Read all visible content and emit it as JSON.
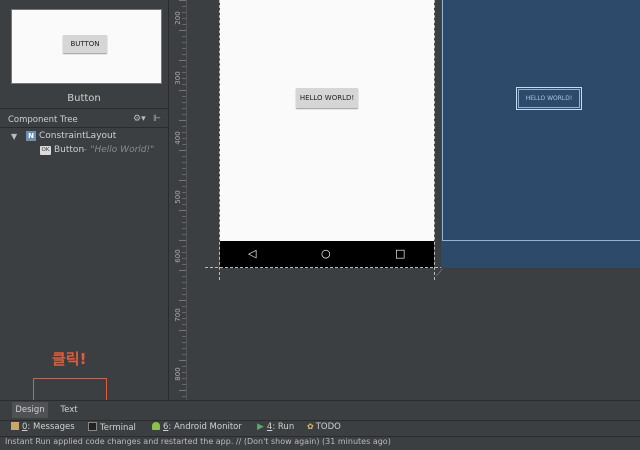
{
  "left_panel": {
    "preview_button_label": "BUTTON",
    "heading": "Button",
    "component_tree": {
      "title": "Component Tree",
      "root_label": "ConstraintLayout",
      "child_badge": "OK",
      "child_label": "Button",
      "child_desc": "– \"Hello World!\""
    }
  },
  "ruler": {
    "labels": [
      "200",
      "300",
      "400",
      "500",
      "600",
      "700",
      "800"
    ]
  },
  "canvas": {
    "hello_button_label": "HELLO WORLD!",
    "blueprint_button_label": "HELLO WORLD!"
  },
  "annotation": {
    "click_text": "클릭!",
    "color": "#e05c3a"
  },
  "editor_tabs": {
    "design": "Design",
    "text": "Text"
  },
  "tool_windows": {
    "messages_num": "0",
    "messages": ": Messages",
    "terminal": "Terminal",
    "android_num": "6",
    "android_monitor": ": Android Monitor",
    "run_num": "4",
    "run": ": Run",
    "todo": "TODO"
  },
  "status": "Instant Run applied code changes and restarted the app. // (Don't show again) (31 minutes ago)",
  "colors": {
    "background": "#3c3f41",
    "blueprint": "#2e4a6b",
    "accent_red": "#e05c3a"
  }
}
